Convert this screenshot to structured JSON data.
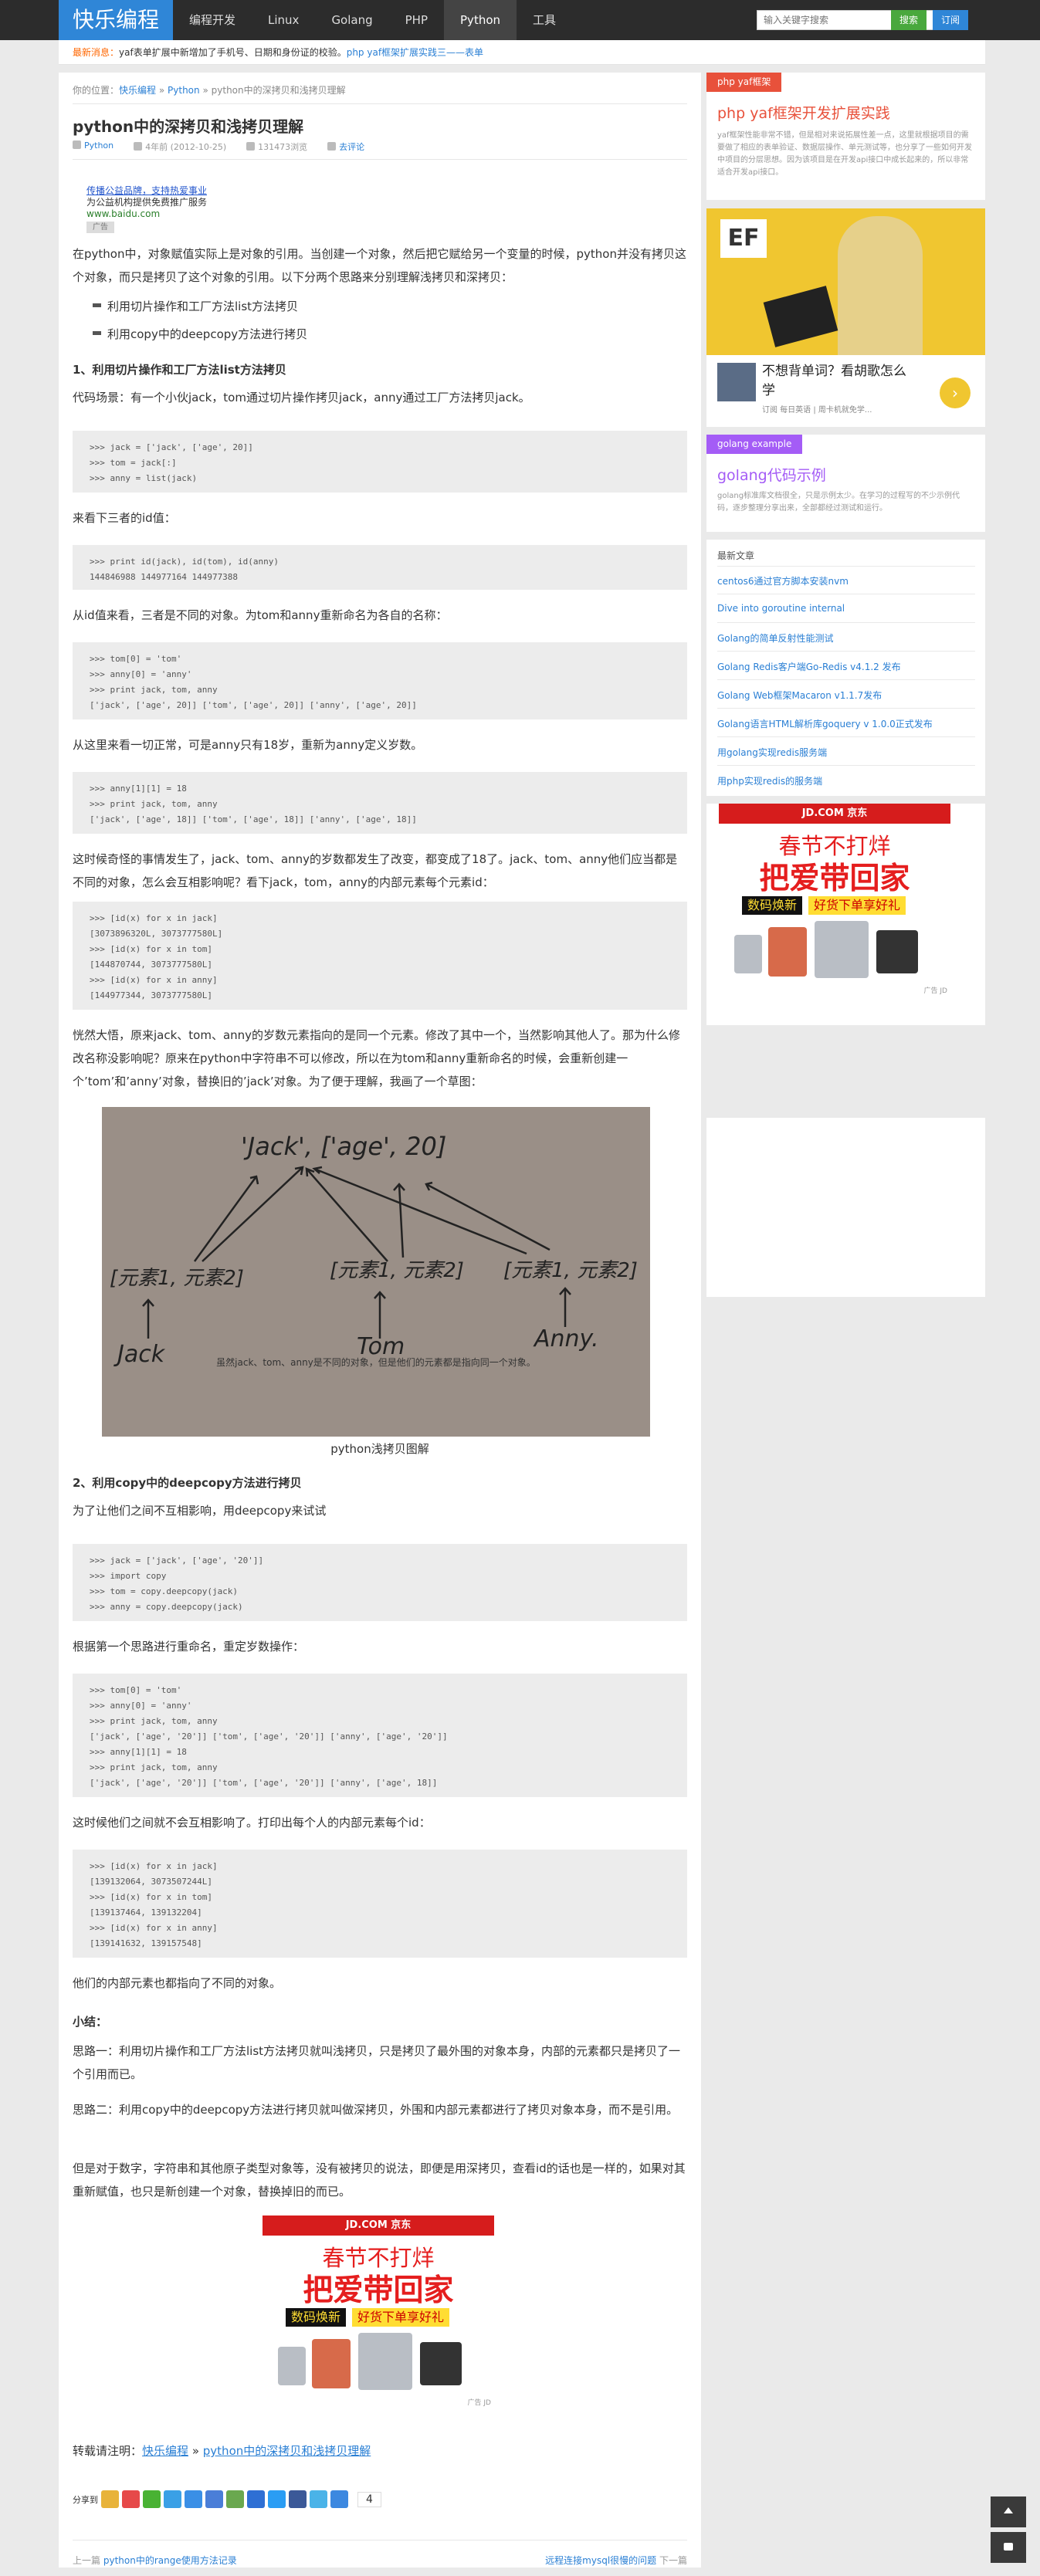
{
  "header": {
    "logo": "快乐编程",
    "nav": [
      "编程开发",
      "Linux",
      "Golang",
      "PHP",
      "Python",
      "工具"
    ],
    "search_placeholder": "输入关键字搜索",
    "search_label": "搜索",
    "subscribe_label": "订阅"
  },
  "notice": {
    "label": "最新消息：",
    "text": "yaf表单扩展中新增加了手机号、日期和身份证的校验。",
    "link": "php yaf框架扩展实践三——表单"
  },
  "breadcrumb": {
    "prefix": "你的位置：",
    "home": "快乐编程",
    "sep": "»",
    "section": "Python",
    "current": "python中的深拷贝和浅拷贝理解"
  },
  "article": {
    "title": "python中的深拷贝和浅拷贝理解",
    "category": "Python",
    "date": "4年前 (2012-10-25)",
    "views": "131473浏览",
    "comments": "去评论",
    "ad": {
      "title": "传播公益品牌，支持热爱事业",
      "line": "为公益机构提供免费推广服务",
      "url": "www.baidu.com",
      "tag": "广告"
    },
    "intro": "在python中，对象赋值实际上是对象的引用。当创建一个对象，然后把它赋给另一个变量的时候，python并没有拷贝这个对象，而只是拷贝了这个对象的引用。以下分两个思路来分别理解浅拷贝和深拷贝：",
    "bullets": [
      "利用切片操作和工厂方法list方法拷贝",
      "利用copy中的deepcopy方法进行拷贝"
    ],
    "h1": "1、利用切片操作和工厂方法list方法拷贝",
    "p_scene": "代码场景：有一个小伙jack，tom通过切片操作拷贝jack，anny通过工厂方法拷贝jack。",
    "code1": ">>> jack = ['jack', ['age', 20]]\n>>> tom = jack[:]\n>>> anny = list(jack)",
    "p_ids": "来看下三者的id值：",
    "code2": ">>> print id(jack), id(tom), id(anny)\n144846988 144977164 144977388",
    "p_rename": "从id值来看，三者是不同的对象。为tom和anny重新命名为各自的名称：",
    "code3": ">>> tom[0] = 'tom'\n>>> anny[0] = 'anny'\n>>> print jack, tom, anny\n['jack', ['age', 20]] ['tom', ['age', 20]] ['anny', ['age', 20]]",
    "p_age": "从这里来看一切正常，可是anny只有18岁，重新为anny定义岁数。",
    "code4": ">>> anny[1][1] = 18\n>>> print jack, tom, anny\n['jack', ['age', 18]] ['tom', ['age', 18]] ['anny', ['age', 18]]",
    "p_weird": "这时候奇怪的事情发生了，jack、tom、anny的岁数都发生了改变，都变成了18了。jack、tom、anny他们应当都是不同的对象，怎么会互相影响呢？看下jack，tom，anny的内部元素每个元素id：",
    "code5": ">>> [id(x) for x in jack]\n[3073896320L, 3073777580L]\n>>> [id(x) for x in tom]\n[144870744, 3073777580L]\n>>> [id(x) for x in anny]\n[144977344, 3073777580L]",
    "p_explain": "恍然大悟，原来jack、tom、anny的岁数元素指向的是同一个元素。修改了其中一个，当然影响其他人了。那为什么修改名称没影响呢？原来在python中字符串不可以修改，所以在为tom和anny重新命名的时候，会重新创建一个’tom’和’anny’对象，替换旧的’jack’对象。为了便于理解，我画了一个草图：",
    "image": {
      "top": "'Jack', ['age', 20]",
      "l1": "[元素1, 元素2]",
      "l2": "[元素1, 元素2]",
      "l3": "[元素1, 元素2]",
      "n1": "Jack",
      "n2": "Tom",
      "n3": "Anny.",
      "note": "虽然jack、tom、anny是不同的对象，但是他们的元素都是指向同一个对象。"
    },
    "image_caption": "python浅拷贝图解",
    "h2": "2、利用copy中的deepcopy方法进行拷贝",
    "p_deep": "为了让他们之间不互相影响，用deepcopy来试试",
    "code6": ">>> jack = ['jack', ['age', '20']]\n>>> import copy\n>>> tom = copy.deepcopy(jack)\n>>> anny = copy.deepcopy(jack)",
    "p_deep2": "根据第一个思路进行重命名，重定岁数操作：",
    "code7": ">>> tom[0] = 'tom'\n>>> anny[0] = 'anny'\n>>> print jack, tom, anny\n['jack', ['age', '20']] ['tom', ['age', '20']] ['anny', ['age', '20']]\n>>> anny[1][1] = 18\n>>> print jack, tom, anny\n['jack', ['age', '20']] ['tom', ['age', '20']] ['anny', ['age', 18]]",
    "p_deep3": "这时候他们之间就不会互相影响了。打印出每个人的内部元素每个id：",
    "code8": ">>> [id(x) for x in jack]\n[139132064, 3073507244L]\n>>> [id(x) for x in tom]\n[139137464, 139132204]\n>>> [id(x) for x in anny]\n[139141632, 139157548]",
    "p_deep4": "他们的内部元素也都指向了不同的对象。",
    "summary_h": "小结：",
    "summary1": "思路一：利用切片操作和工厂方法list方法拷贝就叫浅拷贝，只是拷贝了最外围的对象本身，内部的元素都只是拷贝了一个引用而已。",
    "summary2": "思路二：利用copy中的deepcopy方法进行拷贝就叫做深拷贝，外围和内部元素都进行了拷贝对象本身，而不是引用。",
    "summary3": "但是对于数字，字符串和其他原子类型对象等，没有被拷贝的说法，即便是用深拷贝，查看id的话也是一样的，如果对其重新赋值，也只是新创建一个对象，替换掉旧的而已。",
    "repost": {
      "label": "转载请注明：",
      "site": "快乐编程",
      "sep": "»",
      "title": "python中的深拷贝和浅拷贝理解"
    },
    "share": {
      "label": "分享到",
      "count": "4"
    },
    "prev": {
      "label": "上一篇",
      "title": "python中的range使用方法记录"
    },
    "next": {
      "label": "下一篇",
      "title": "远程连接mysql很慢的问题"
    }
  },
  "jd_ad": {
    "brand": "JD.COM 京东",
    "line1": "春节不打烊",
    "line2": "把爱带回家",
    "tag1": "数码焕新",
    "tag2": "好货下单享好礼",
    "adtag": "广告 JD"
  },
  "sidebar": {
    "yaf": {
      "tag": "php yaf框架",
      "title": "php yaf框架开发扩展实践",
      "desc": "yaf框架性能非常不错，但是相对来说拓展性差一点，这里就根据项目的需要做了相应的表单验证、数据层操作、单元测试等，也分享了一些如何开发中项目的分层思想。因为该项目是在开发api接口中成长起来的，所以非常适合开发api接口。"
    },
    "ef_ad": {
      "title": "不想背单词？看胡歌怎么学",
      "sub": "订阅 每日英语 | 周卡机就免学..."
    },
    "golang": {
      "tag": "golang example",
      "title": "golang代码示例",
      "desc": "golang标准库文档很全，只是示例太少。在学习的过程写的不少示例代码，逐步整理分享出来，全部都经过测试和运行。"
    },
    "recent": {
      "title": "最新文章",
      "items": [
        "centos6通过官方脚本安装nvm",
        "Dive into goroutine internal",
        "Golang的简单反射性能测试",
        "Golang Redis客户端Go-Redis v4.1.2 发布",
        "Golang Web框架Macaron v1.1.7发布",
        "Golang语言HTML解析库goquery v 1.0.0正式发布",
        "用golang实现redis服务端",
        "用php实现redis的服务端"
      ]
    }
  },
  "colors": {
    "brand": "#2f86d7",
    "tag_red": "#e8513b",
    "tag_purple": "#a45cf6",
    "link": "#2a7fd4"
  }
}
